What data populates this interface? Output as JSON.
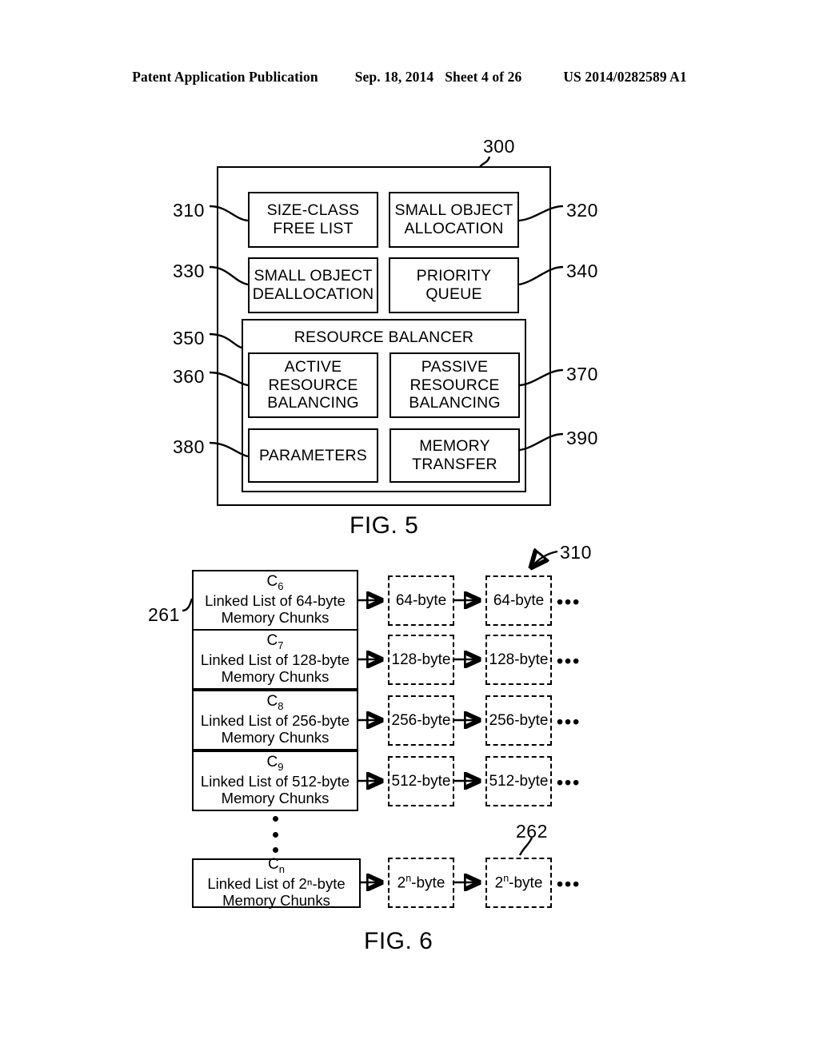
{
  "header": {
    "title": "Patent Application Publication",
    "date": "Sep. 18, 2014",
    "sheet": "Sheet 4 of 26",
    "pub_number": "US 2014/0282589 A1"
  },
  "fig5": {
    "caption": "FIG. 5",
    "outer_ref": "300",
    "boxes": [
      {
        "ref": "310",
        "label": "SIZE-CLASS\nFREE LIST"
      },
      {
        "ref": "320",
        "label": "SMALL OBJECT\nALLOCATION"
      },
      {
        "ref": "330",
        "label": "SMALL OBJECT\nDEALLOCATION"
      },
      {
        "ref": "340",
        "label": "PRIORITY\nQUEUE"
      }
    ],
    "balancer": {
      "ref": "350",
      "title": "RESOURCE BALANCER",
      "boxes": [
        {
          "ref": "360",
          "label": "ACTIVE\nRESOURCE\nBALANCING"
        },
        {
          "ref": "370",
          "label": "PASSIVE\nRESOURCE\nBALANCING"
        },
        {
          "ref": "380",
          "label": "PARAMETERS"
        },
        {
          "ref": "390",
          "label": "MEMORY\nTRANSFER"
        }
      ]
    }
  },
  "fig6": {
    "caption": "FIG. 6",
    "ref_list_head": "261",
    "ref_chunk": "262",
    "ref_freelist": "310",
    "ellipsis": "•••",
    "rows": [
      {
        "class": "C",
        "sub": "6",
        "desc": "Linked List of 64-byte\nMemory Chunks",
        "chunk": "64-byte",
        "chunk_exp": ""
      },
      {
        "class": "C",
        "sub": "7",
        "desc": "Linked List of 128-byte\nMemory Chunks",
        "chunk": "128-byte",
        "chunk_exp": ""
      },
      {
        "class": "C",
        "sub": "8",
        "desc": "Linked List of 256-byte\nMemory Chunks",
        "chunk": "256-byte",
        "chunk_exp": ""
      },
      {
        "class": "C",
        "sub": "9",
        "desc": "Linked List of 512-byte\nMemory Chunks",
        "chunk": "512-byte",
        "chunk_exp": ""
      },
      {
        "class": "C",
        "sub": "n",
        "desc": "Linked List of 2ⁿ-byte\nMemory Chunks",
        "chunk": "2",
        "chunk_exp": "n",
        "chunk_suffix": "-byte"
      }
    ]
  }
}
